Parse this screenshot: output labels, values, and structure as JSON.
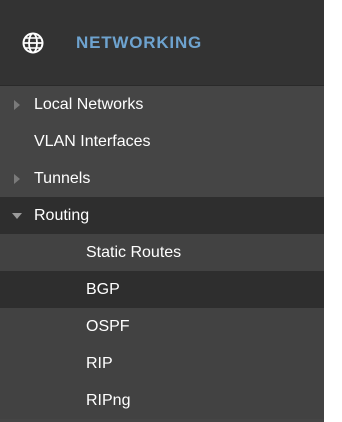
{
  "section": {
    "title": "NETWORKING",
    "icon": "globe-icon",
    "title_color": "#6ea3cf"
  },
  "items": [
    {
      "label": "Local Networks",
      "icon": "chevron-right-icon"
    },
    {
      "label": "VLAN Interfaces",
      "icon": ""
    },
    {
      "label": "Tunnels",
      "icon": "chevron-right-icon"
    },
    {
      "label": "Routing",
      "icon": "chevron-down-icon",
      "expanded": true
    }
  ],
  "routing_children": [
    {
      "label": "Static Routes",
      "selected": false
    },
    {
      "label": "BGP",
      "selected": true
    },
    {
      "label": "OSPF",
      "selected": false
    },
    {
      "label": "RIP",
      "selected": false
    },
    {
      "label": "RIPng",
      "selected": false
    }
  ]
}
